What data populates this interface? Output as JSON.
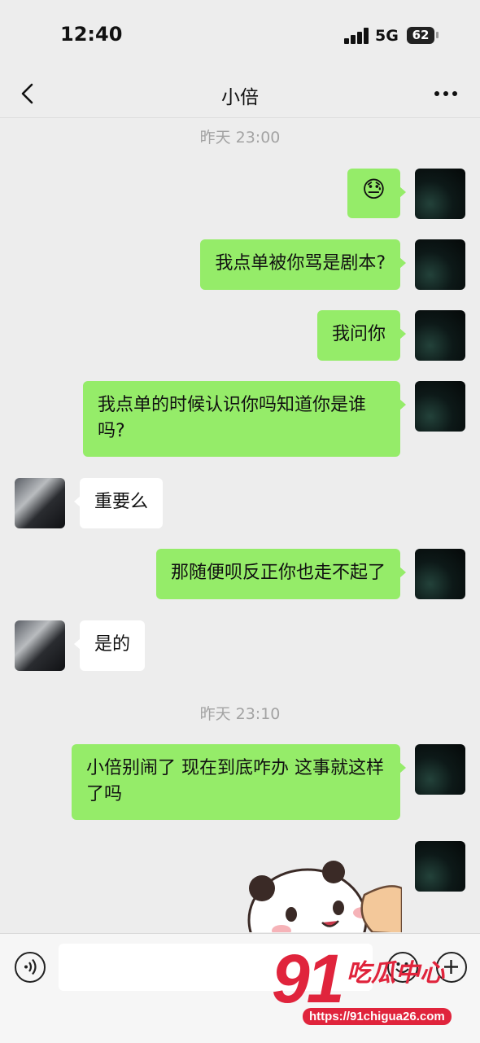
{
  "status_bar": {
    "time": "12:40",
    "network": "5G",
    "battery": "62"
  },
  "header": {
    "title": "小倍"
  },
  "timestamps": [
    "昨天 23:00",
    "昨天 23:10"
  ],
  "messages": [
    {
      "from": "me",
      "text": "😓",
      "kind": "emoji"
    },
    {
      "from": "me",
      "text": "我点单被你骂是剧本?"
    },
    {
      "from": "me",
      "text": "我问你"
    },
    {
      "from": "me",
      "text": "我点单的时候认识你吗知道你是谁吗?"
    },
    {
      "from": "other",
      "text": "重要么"
    },
    {
      "from": "me",
      "text": "那随便呗反正你也走不起了"
    },
    {
      "from": "other",
      "text": "是的"
    },
    {
      "from": "me",
      "text": "小倍别闹了 现在到底咋办 这事就这样了吗"
    },
    {
      "from": "me",
      "kind": "sticker",
      "sticker": "panda-sticker"
    }
  ],
  "input": {
    "placeholder": ""
  },
  "icons": {
    "back": "back-chevron-icon",
    "more": "more-dots-icon",
    "voice": "voice-icon",
    "emoji": "emoji-icon",
    "plus": "plus-icon"
  },
  "colors": {
    "sent_bubble": "#95ec69",
    "received_bubble": "#ffffff",
    "background": "#ededed",
    "watermark": "#e0243c"
  },
  "watermark": {
    "number": "91",
    "text": "吃瓜中心",
    "url": "https://91chigua26.com"
  }
}
